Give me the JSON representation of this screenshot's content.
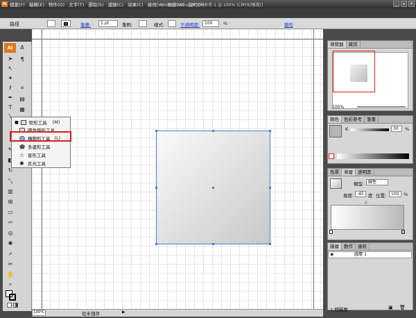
{
  "window": {
    "title": "Adobe Illustrator - [未命名-1 @ 100% (CMYK/預視)]",
    "app_badge": "Ai",
    "buttons": [
      "_",
      "▫",
      "×"
    ]
  },
  "menu": [
    "檔案(F)",
    "編輯(E)",
    "物件(O)",
    "文字(T)",
    "選取(S)",
    "濾鏡(C)",
    "效果(C)",
    "檢視(V)",
    "視窗(W)",
    "說明(H)"
  ],
  "control_bar": {
    "path_label": "路徑",
    "stroke_label": "筆畫:",
    "stroke_value": "1 pt",
    "brush_label": "筆刷:",
    "style_label": "樣式:",
    "opacity_label": "不透明度:",
    "opacity_value": "100",
    "opacity_unit": "%",
    "transform_label": "變形"
  },
  "flyout": {
    "items": [
      {
        "label": "矩形工具",
        "shortcut": "(M)"
      },
      {
        "label": "圓角矩形工具",
        "shortcut": ""
      },
      {
        "label": "橢圓形工具",
        "shortcut": "(L)"
      },
      {
        "label": "多邊形工具",
        "shortcut": ""
      },
      {
        "label": "星形工具",
        "shortcut": ""
      },
      {
        "label": "反光工具",
        "shortcut": ""
      }
    ]
  },
  "status": {
    "zoom": "100%",
    "text": "從未儲存"
  },
  "navigator": {
    "tabs": [
      "導覽器",
      "資訊"
    ],
    "zoom": "100%"
  },
  "color": {
    "tabs": [
      "顏色",
      "色彩參考",
      "筆畫"
    ],
    "channel": "K",
    "value": "30",
    "unit": "%"
  },
  "gradient": {
    "tabs": [
      "色票",
      "漸層",
      "透明度"
    ],
    "type_label": "類型:",
    "type_value": "線性",
    "angle_label": "角度:",
    "angle_value": "-45",
    "angle_unit": "度",
    "position_label": "位置:",
    "position_value": "100",
    "position_unit": "%"
  },
  "layers": {
    "tabs": [
      "圖層",
      "動作",
      "連結"
    ],
    "row_label": "圖層 1",
    "footer": "1 個圖層"
  },
  "colors": {
    "accent": "#4a7ad6",
    "highlight": "#d81e1e",
    "ai_brand": "#e07a18"
  }
}
